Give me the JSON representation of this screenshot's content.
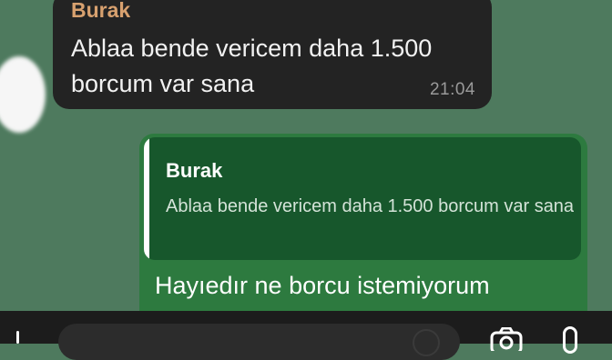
{
  "incoming_message": {
    "sender": "Burak",
    "text": "Ablaa bende vericem daha 1.500 borcum var sana",
    "time": "21:04"
  },
  "outgoing_message": {
    "reply_to": {
      "sender": "Burak",
      "text": "Ablaa bende vericem daha 1.500 borcum var sana"
    },
    "text": "Hayıedır ne borcu istemiyorum"
  },
  "colors": {
    "chat_background": "#4e7a5e",
    "incoming_bubble": "#232323",
    "outgoing_bubble": "#2d7a3f",
    "reply_quote": "#17572c",
    "sender_name_incoming": "#d8a16f"
  },
  "icons": {
    "attach": "attach-icon",
    "sticker": "sticker-icon",
    "camera": "camera-icon",
    "microphone": "microphone-icon"
  }
}
